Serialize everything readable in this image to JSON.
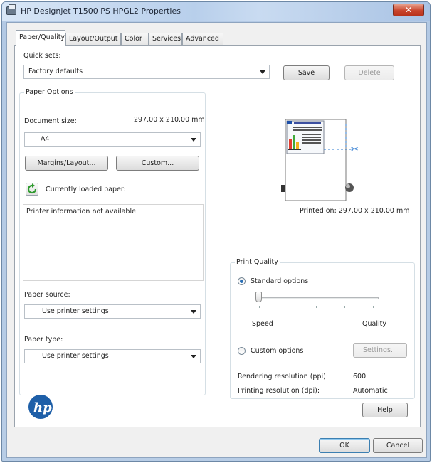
{
  "window": {
    "title": "HP Designjet T1500 PS HPGL2 Properties",
    "close_glyph": "✕"
  },
  "tabs": [
    {
      "label": "Paper/Quality",
      "active": true
    },
    {
      "label": "Layout/Output",
      "active": false
    },
    {
      "label": "Color",
      "active": false
    },
    {
      "label": "Services",
      "active": false
    },
    {
      "label": "Advanced",
      "active": false
    }
  ],
  "quick_sets": {
    "label": "Quick sets:",
    "value": "Factory defaults",
    "save_label": "Save",
    "delete_label": "Delete"
  },
  "paper_options": {
    "title": "Paper Options",
    "document_size_label": "Document size:",
    "document_size_value": "297.00 x 210.00 mm",
    "size_select": "A4",
    "margins_button": "Margins/Layout...",
    "custom_button": "Custom...",
    "loaded_paper_label": "Currently loaded paper:",
    "info_text": "Printer information not available",
    "paper_source_label": "Paper source:",
    "paper_source_value": "Use printer settings",
    "paper_type_label": "Paper type:",
    "paper_type_value": "Use printer settings"
  },
  "preview": {
    "printed_on": "Printed on: 297.00 x 210.00 mm"
  },
  "print_quality": {
    "title": "Print Quality",
    "standard_label": "Standard options",
    "speed_label": "Speed",
    "quality_label": "Quality",
    "custom_label": "Custom options",
    "settings_button": "Settings...",
    "slider_level": 0,
    "rendering_label": "Rendering resolution (ppi):",
    "rendering_value": "600",
    "printing_label": "Printing resolution (dpi):",
    "printing_value": "Automatic"
  },
  "footer": {
    "help_label": "Help",
    "ok_label": "OK",
    "cancel_label": "Cancel"
  },
  "colors": {
    "hp_logo": "#1e5fa8",
    "accent": "#2a6fb6"
  }
}
